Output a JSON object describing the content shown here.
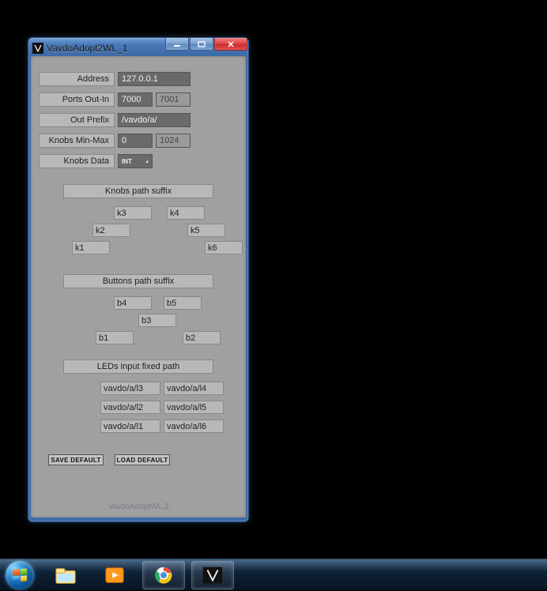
{
  "window": {
    "title": "VavdoAdopt2WL_1",
    "footer": "VavdoAdoptWL.2"
  },
  "form": {
    "address_label": "Address",
    "address_value": "127.0.0.1",
    "ports_label": "Ports Out-In",
    "port_out": "7000",
    "port_in": "7001",
    "outprefix_label": "Out Prefix",
    "outprefix_value": "/vavdo/a/",
    "knobs_minmax_label": "Knobs Min-Max",
    "knobs_min": "0",
    "knobs_max": "1024",
    "knobs_data_label": "Knobs Data",
    "knobs_data_value": "INT"
  },
  "sections": {
    "knobs_header": "Knobs path suffix",
    "buttons_header": "Buttons path suffix",
    "leds_header": "LEDs input fixed path"
  },
  "knobs": {
    "k1": "k1",
    "k2": "k2",
    "k3": "k3",
    "k4": "k4",
    "k5": "k5",
    "k6": "k6"
  },
  "buttons": {
    "b1": "b1",
    "b2": "b2",
    "b3": "b3",
    "b4": "b4",
    "b5": "b5"
  },
  "leds": {
    "l1": "vavdo/a/l1",
    "l2": "vavdo/a/l2",
    "l3": "vavdo/a/l3",
    "l4": "vavdo/a/l4",
    "l5": "vavdo/a/l5",
    "l6": "vavdo/a/l6"
  },
  "actions": {
    "save": "SAVE DEFAULT",
    "load": "LOAD DEFAULT"
  },
  "taskbar": {
    "items": [
      "explorer",
      "media-player",
      "chrome",
      "vavdo"
    ]
  }
}
